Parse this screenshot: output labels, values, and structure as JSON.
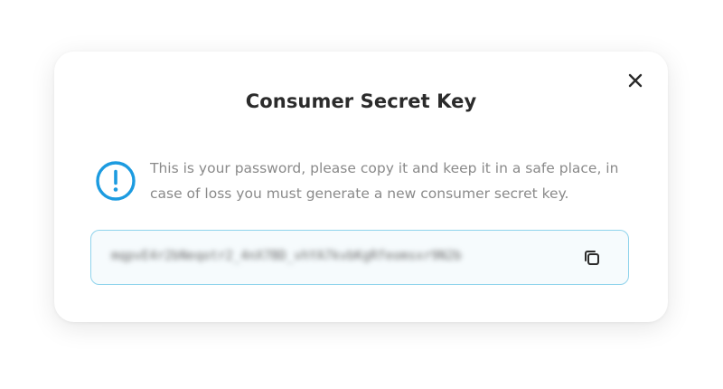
{
  "dialog": {
    "title": "Consumer Secret Key",
    "close_icon": "close-icon",
    "notice": {
      "icon": "exclamation-circle-icon",
      "text": "This is your password, please copy it and keep it in a safe place, in case of loss you must generate a new consumer secret key."
    },
    "secret_key": {
      "value": "mqpvE4r2bNeqotr2_4nX7BD_vhYA7kvbKgRfeomsxr9N2b",
      "copy_icon": "copy-icon"
    }
  },
  "colors": {
    "accent": "#1c9be0",
    "field_border": "#8fd3ec",
    "field_bg": "#f6fbfd",
    "title": "#2b2b2b",
    "text_muted": "#8a8a8a"
  }
}
